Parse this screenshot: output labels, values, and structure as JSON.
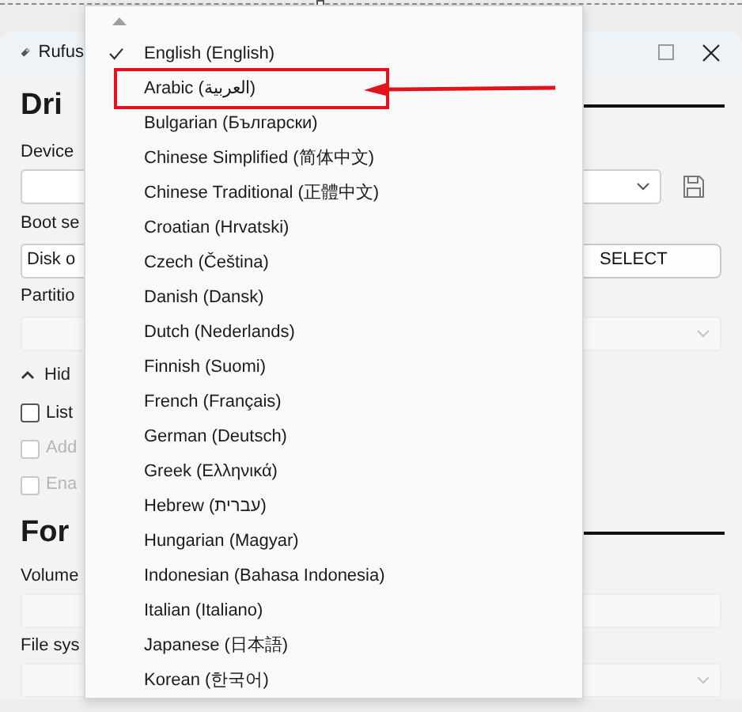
{
  "window": {
    "title": "Rufus",
    "drive_heading": "Dri",
    "device_label": "Device",
    "boot_label": "Boot se",
    "boot_value": "Disk o",
    "select_button": "SELECT",
    "partition_label": "Partitio",
    "advanced_toggle": {
      "label": "Hid",
      "expanded": true
    },
    "options": [
      {
        "label": "List",
        "checked": false,
        "disabled": false
      },
      {
        "label": "Add",
        "checked": false,
        "disabled": true
      },
      {
        "label": "Ena",
        "checked": false,
        "disabled": true
      }
    ],
    "format_heading": "For",
    "volume_label": "Volume",
    "filesystem_label": "File sys"
  },
  "language_menu": {
    "items": [
      {
        "label": "English (English)",
        "checked": true,
        "annotated": false
      },
      {
        "label": "Arabic (العربية)",
        "checked": false,
        "annotated": true
      },
      {
        "label": "Bulgarian (Български)",
        "checked": false,
        "annotated": false
      },
      {
        "label": "Chinese Simplified (简体中文)",
        "checked": false,
        "annotated": false
      },
      {
        "label": "Chinese Traditional (正體中文)",
        "checked": false,
        "annotated": false
      },
      {
        "label": "Croatian (Hrvatski)",
        "checked": false,
        "annotated": false
      },
      {
        "label": "Czech (Čeština)",
        "checked": false,
        "annotated": false
      },
      {
        "label": "Danish (Dansk)",
        "checked": false,
        "annotated": false
      },
      {
        "label": "Dutch (Nederlands)",
        "checked": false,
        "annotated": false
      },
      {
        "label": "Finnish (Suomi)",
        "checked": false,
        "annotated": false
      },
      {
        "label": "French (Français)",
        "checked": false,
        "annotated": false
      },
      {
        "label": "German (Deutsch)",
        "checked": false,
        "annotated": false
      },
      {
        "label": "Greek (Ελληνικά)",
        "checked": false,
        "annotated": false
      },
      {
        "label": "Hebrew (עברית)",
        "checked": false,
        "annotated": false
      },
      {
        "label": "Hungarian (Magyar)",
        "checked": false,
        "annotated": false
      },
      {
        "label": "Indonesian (Bahasa Indonesia)",
        "checked": false,
        "annotated": false
      },
      {
        "label": "Italian (Italiano)",
        "checked": false,
        "annotated": false
      },
      {
        "label": "Japanese (日本語)",
        "checked": false,
        "annotated": false
      },
      {
        "label": "Korean (한국어)",
        "checked": false,
        "annotated": false
      }
    ]
  }
}
